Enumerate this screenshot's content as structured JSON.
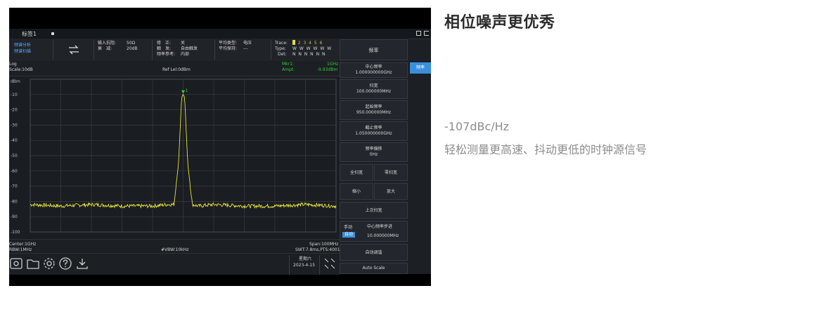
{
  "title_bar": {
    "tab_label": "标签1"
  },
  "info_bar": {
    "mode_line1": "频谱分析",
    "mode_line2": "频谱扫描",
    "impedance_label": "输入抗阻:",
    "impedance_value": "50Ω",
    "atten_label": "衰　减:",
    "atten_value": "20dB",
    "corr_label": "修　正:",
    "corr_value": "关",
    "trig_label": "触　发:",
    "trig_value": "自由触发",
    "ref_label": "频率参考:",
    "ref_value": "内部",
    "avg_type_label": "平均类型:",
    "avg_type_value": "电压",
    "avg_count_label": "平均保持:",
    "avg_count_value": "---",
    "trace_label": "Trace:",
    "trace_nums": "1 2 3 4 5 6",
    "type_label": "Type:",
    "type_values": "W W W W W W",
    "det_label": "Det:",
    "det_values": "N N N N N N"
  },
  "plot_header": {
    "scale_type": "Log",
    "scale": "Scale:10dB",
    "ref_level": "Ref Lel:0dBm",
    "marker_label": "Mkr1:",
    "marker_freq": "1GHz",
    "ampt_label": "Ampt:",
    "ampt_value": "-9.93dBm"
  },
  "y_axis": {
    "unit": "dBm",
    "ticks": [
      "-10",
      "-20",
      "-30",
      "-40",
      "-50",
      "-60",
      "-70",
      "-80",
      "-90",
      "-100"
    ]
  },
  "plot_footer": {
    "center": "Center:1GHz",
    "rbw": "RBW:1MHz",
    "vbw": "#VBW:10kHz",
    "span": "Span:100MHz",
    "swt": "SWT:7.8ms,PTS:4001"
  },
  "toolbar": {
    "weekday": "星期六",
    "date": "2023-4-15"
  },
  "menu": {
    "header": "频率",
    "side_tab": "频率",
    "center_freq_label": "中心频率",
    "center_freq_value": "1.000000000GHz",
    "span_label": "扫宽",
    "span_value": "100.000000MHz",
    "start_label": "起始频率",
    "start_value": "950.000000MHz",
    "stop_label": "截止频率",
    "stop_value": "1.050000000GHz",
    "offset_label": "频率偏移",
    "offset_value": "0Hz",
    "full_span": "全扫宽",
    "zero_span": "零扫宽",
    "zoom_out": "缩小",
    "zoom_in": "放大",
    "last_span": "上次扫宽",
    "step_manual": "手动",
    "step_auto": "自动",
    "step_label": "中心频率步进",
    "step_value": "10.000000MHz",
    "auto_tune": "自动调谐",
    "auto_scale": "Auto Scale"
  },
  "chart_data": {
    "type": "line",
    "title": "",
    "xlabel": "",
    "ylabel": "dBm",
    "xlim": [
      950,
      1050
    ],
    "ylim": [
      -100,
      0
    ],
    "grid": true,
    "x": [
      950,
      960,
      970,
      980,
      990,
      995,
      997,
      998.5,
      999.5,
      1000,
      1000.5,
      1001.5,
      1003,
      1005,
      1010,
      1020,
      1030,
      1040,
      1050
    ],
    "series": [
      {
        "values": [
          -82,
          -83,
          -82,
          -83,
          -83,
          -82,
          -82,
          -55,
          -12,
          -10,
          -12,
          -55,
          -82,
          -83,
          -82,
          -83,
          -83,
          -82,
          -83
        ]
      }
    ],
    "annotations": [
      "1"
    ],
    "color": "#e8e33a"
  },
  "heading": "相位噪声更优秀",
  "spec": "-107dBc/Hz",
  "description": "轻松测量更高速、抖动更低的时钟源信号"
}
